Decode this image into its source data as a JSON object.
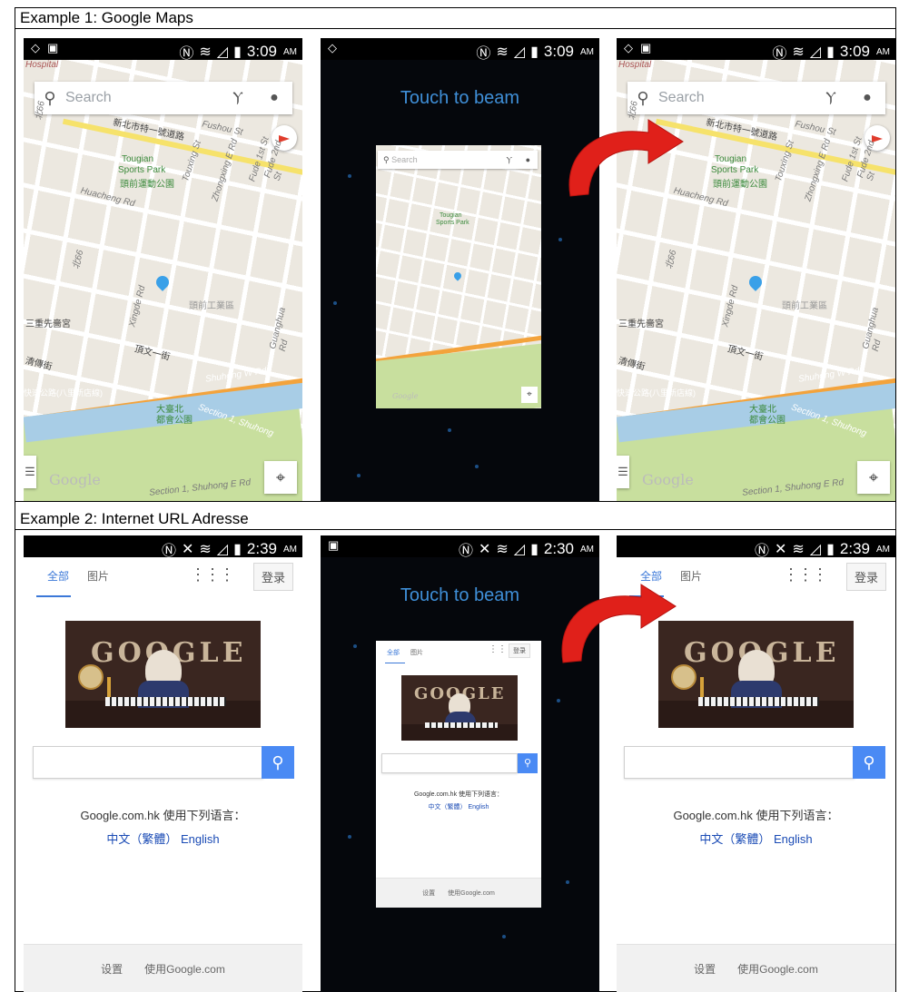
{
  "example1": {
    "caption": "Example 1: Google Maps",
    "left": {
      "status": {
        "time": "3:09",
        "ampm": "AM"
      },
      "search_placeholder": "Search",
      "labels": {
        "hospital": "Hospital",
        "fushou": "Fushou St",
        "tougian": "Tougian",
        "sports_park": "Sports Park",
        "sports_park_zh": "頭前運動公園",
        "huacheng": "Huacheng Rd",
        "touxing": "Touxing St",
        "zhongxing": "Zhongxing E Rd",
        "fude1": "Fude 1st St",
        "fude2": "Fude 2nd St",
        "xingde": "Xingde Rd",
        "guanghua": "Guanghua Rd",
        "shuhong_w": "Shuhong W Rd",
        "datai": "大臺北",
        "dahui": "都會公園",
        "section1": "Section 1, Shuhong",
        "section1_e": "Section 1, Shuhong E Rd",
        "google": "Google",
        "sanchong": "三重先嗇宮",
        "dingwen": "頂文一街",
        "tutou": "頭前工業區",
        "bei66": "北66",
        "xinbei": "新北市特一號道路",
        "qingjie": "清傳街",
        "kuaisu": "快速公路(八里新店線)"
      }
    },
    "middle": {
      "status": {
        "time": "3:09",
        "ampm": "AM"
      },
      "touch_to_beam": "Touch to beam",
      "mini_search": "Search",
      "mini_google": "Google",
      "mini_tougian": "Tougian",
      "mini_sports": "Sports Park"
    },
    "right": {
      "status": {
        "time": "3:09",
        "ampm": "AM"
      },
      "search_placeholder": "Search",
      "labels": {
        "hospital": "Hospital",
        "fushou": "Fushou St",
        "tougian": "Tougian",
        "sports_park": "Sports Park",
        "sports_park_zh": "頭前運動公園",
        "huacheng": "Huacheng Rd",
        "touxing": "Touxing St",
        "zhongxing": "Zhongxing E Rd",
        "fude1": "Fude 1st St",
        "fude2": "Fude 2nd St",
        "xingde": "Xingde Rd",
        "guanghua": "Guanghua Rd",
        "shuhong_w": "Shuhong W Rd",
        "datai": "大臺北",
        "dahui": "都會公園",
        "section1": "Section 1, Shuhong",
        "section1_e": "Section 1, Shuhong E Rd",
        "google": "Google",
        "sanchong": "三重先嗇宮",
        "dingwen": "頂文一街",
        "tutou": "頭前工業區",
        "bei66": "北66",
        "xinbei": "新北市特一號道路",
        "qingjie": "清傳街",
        "kuaisu": "快速公路(八里新店線)"
      }
    }
  },
  "example2": {
    "caption": "Example 2: Internet URL Adresse",
    "left": {
      "status": {
        "time": "2:39",
        "ampm": "AM"
      },
      "tab_all": "全部",
      "tab_images": "图片",
      "login": "登录",
      "offered_in": "Google.com.hk 使用下列语言：",
      "lang_zh": "中文（繁體）",
      "lang_en": "English",
      "footer_settings": "设置",
      "footer_use": "使用Google.com"
    },
    "middle": {
      "status": {
        "time": "2:30",
        "ampm": "AM"
      },
      "touch_to_beam": "Touch to beam",
      "tab_all": "全部",
      "tab_images": "图片",
      "login": "登录",
      "offered_in": "Google.com.hk 使用下列语言：",
      "lang_zh": "中文（繁體）",
      "lang_en": "English",
      "footer_settings": "设置",
      "footer_use": "使用Google.com"
    },
    "right": {
      "status": {
        "time": "2:39",
        "ampm": "AM"
      },
      "tab_all": "全部",
      "tab_images": "图片",
      "login": "登录",
      "offered_in": "Google.com.hk 使用下列语言：",
      "lang_zh": "中文（繁體）",
      "lang_en": "English",
      "footer_settings": "设置",
      "footer_use": "使用Google.com"
    }
  },
  "colors": {
    "beam_title": "#3f8fd8",
    "google_blue": "#4a8af4",
    "arrow_red": "#e0201a"
  },
  "icons": [
    "search-icon",
    "directions-icon",
    "account-icon",
    "compass-icon",
    "my-location-icon",
    "menu-icon",
    "apps-grid-icon",
    "nfc-icon",
    "wifi-icon",
    "signal-icon",
    "battery-icon",
    "curved-arrow-icon"
  ]
}
